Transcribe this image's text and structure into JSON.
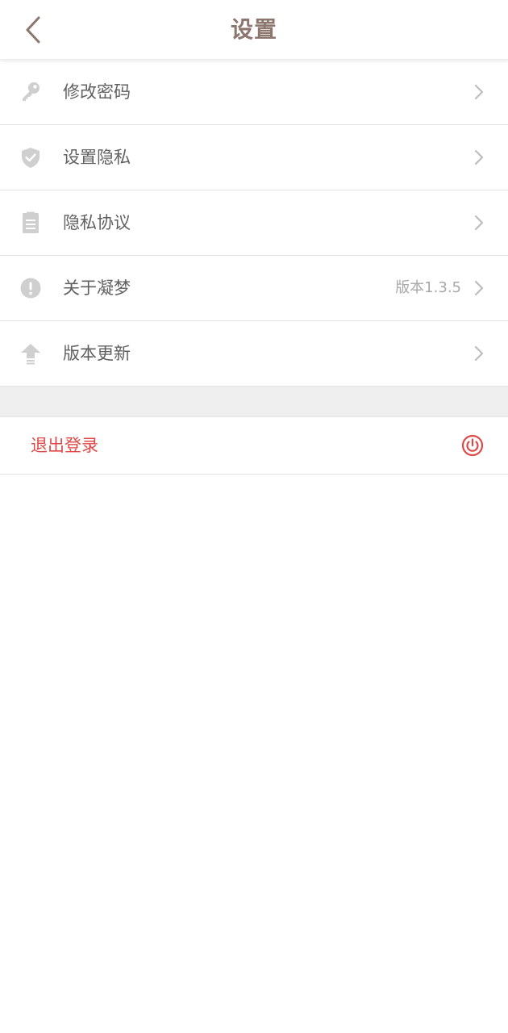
{
  "header": {
    "title": "设置",
    "back_icon": "chevron-left-icon"
  },
  "menu": {
    "items": [
      {
        "label": "修改密码",
        "icon": "key-icon",
        "value": ""
      },
      {
        "label": "设置隐私",
        "icon": "shield-check-icon",
        "value": ""
      },
      {
        "label": "隐私协议",
        "icon": "document-icon",
        "value": ""
      },
      {
        "label": "关于凝梦",
        "icon": "info-icon",
        "value": "版本1.3.5"
      },
      {
        "label": "版本更新",
        "icon": "upload-arrow-icon",
        "value": ""
      }
    ]
  },
  "logout": {
    "label": "退出登录",
    "icon": "power-icon"
  },
  "colors": {
    "title": "#8c766d",
    "label": "#606060",
    "icon": "#cfcfcf",
    "chevron": "#bdbdbd",
    "danger": "#e04848",
    "divider": "#e4e4e4",
    "gap": "#efefef"
  }
}
